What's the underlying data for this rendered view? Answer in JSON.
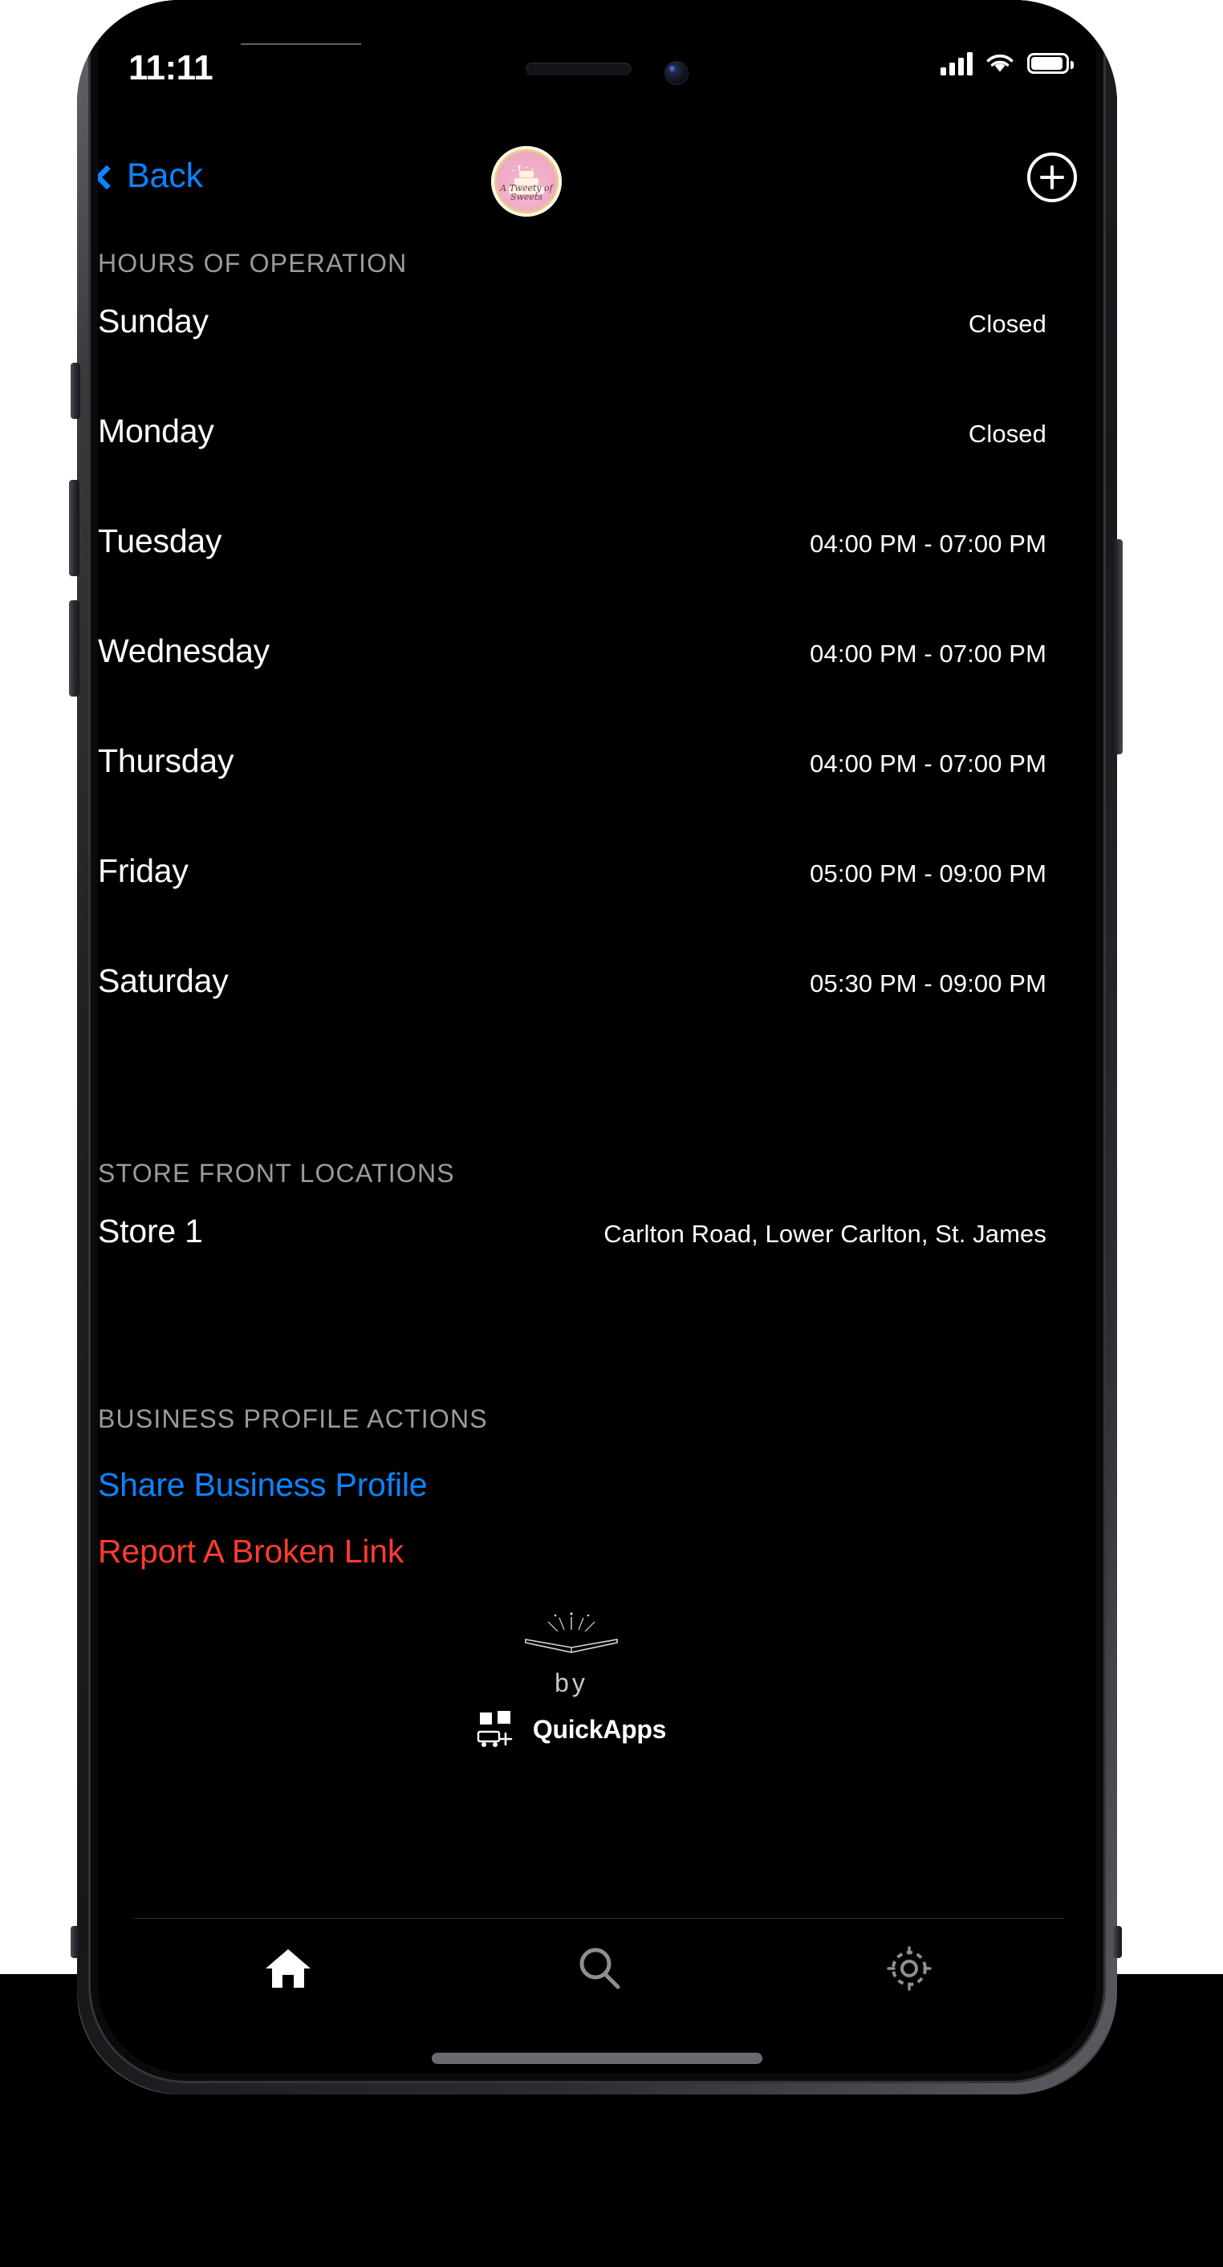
{
  "status_bar": {
    "time": "11:11",
    "signal_icon": "cellular-signal-icon",
    "wifi_icon": "wifi-icon",
    "battery_icon": "battery-icon"
  },
  "nav": {
    "back_label": "Back",
    "back_icon": "chevron-left-icon",
    "avatar_name": "bakery-logo-avatar",
    "avatar_script_line1": "A Tweety of",
    "avatar_script_line2": "Sweets",
    "add_label": "+",
    "add_icon": "plus-circle-icon"
  },
  "sections": {
    "hours": {
      "header": "HOURS OF OPERATION",
      "rows": [
        {
          "day": "Sunday",
          "hours": "Closed"
        },
        {
          "day": "Monday",
          "hours": "Closed"
        },
        {
          "day": "Tuesday",
          "hours": "04:00 PM - 07:00 PM"
        },
        {
          "day": "Wednesday",
          "hours": "04:00 PM - 07:00 PM"
        },
        {
          "day": "Thursday",
          "hours": "04:00 PM - 07:00 PM"
        },
        {
          "day": "Friday",
          "hours": "05:00 PM - 09:00 PM"
        },
        {
          "day": "Saturday",
          "hours": "05:30 PM - 09:00 PM"
        }
      ]
    },
    "locations": {
      "header": "STORE FRONT LOCATIONS",
      "rows": [
        {
          "name": "Store 1",
          "address": "Carlton Road, Lower Carlton, St. James"
        }
      ]
    },
    "actions": {
      "header": "BUSINESS PROFILE ACTIONS",
      "share_label": "Share Business Profile",
      "report_label": "Report A Broken Link"
    }
  },
  "footer": {
    "book_icon": "open-book-icon",
    "by_label": "by",
    "app_mark_icon": "quickapps-logo-icon",
    "app_name": "QuickApps"
  },
  "tabbar": {
    "tabs": [
      {
        "name": "home",
        "icon": "home-icon",
        "active": true
      },
      {
        "name": "search",
        "icon": "search-icon",
        "active": false
      },
      {
        "name": "settings",
        "icon": "gear-icon",
        "active": false
      }
    ]
  },
  "colors": {
    "accent_blue": "#0a84ff",
    "danger_red": "#ff3b30",
    "background": "#000000",
    "section_header": "#9b9b9f",
    "avatar_pink": "#f0a8c4"
  }
}
